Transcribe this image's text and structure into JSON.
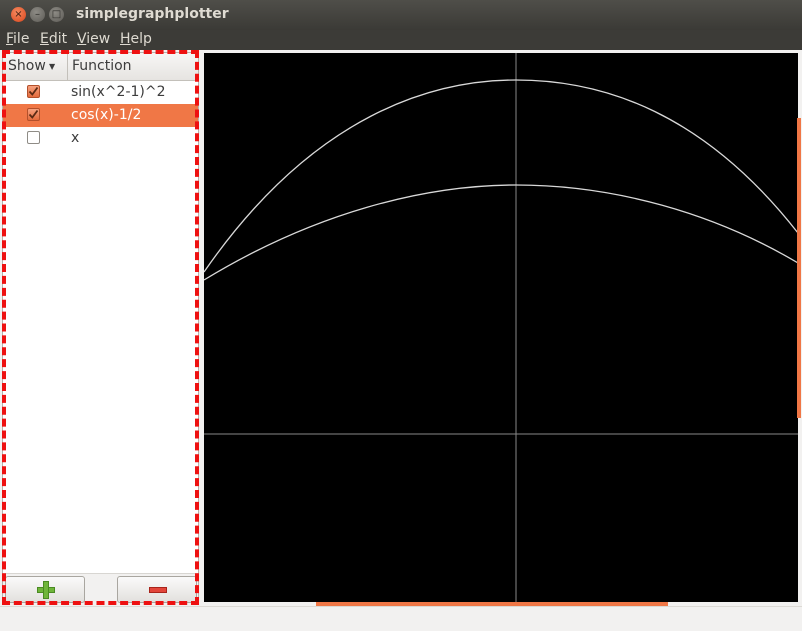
{
  "window": {
    "title": "simplegraphplotter",
    "close_glyph": "×",
    "minimize_glyph": "–",
    "maximize_glyph": "□"
  },
  "menubar": {
    "items": [
      {
        "mnemonic": "F",
        "rest": "ile"
      },
      {
        "mnemonic": "E",
        "rest": "dit"
      },
      {
        "mnemonic": "V",
        "rest": "iew"
      },
      {
        "mnemonic": "H",
        "rest": "elp"
      }
    ]
  },
  "function_list": {
    "columns": {
      "show": "Show",
      "sort_arrow": "▼",
      "function": "Function"
    },
    "rows": [
      {
        "function": "sin(x^2-1)^2",
        "show": true,
        "selected": false
      },
      {
        "function": "cos(x)-1/2",
        "show": true,
        "selected": true
      },
      {
        "function": "x",
        "show": false,
        "selected": false
      }
    ],
    "buttons": {
      "add_icon": "plus-icon",
      "remove_icon": "minus-icon"
    }
  },
  "colors": {
    "accent": "#f07746",
    "highlight_outline": "#ee1111",
    "plot_background": "#000000",
    "curve": "#d8d8d8",
    "axis": "#888888"
  }
}
